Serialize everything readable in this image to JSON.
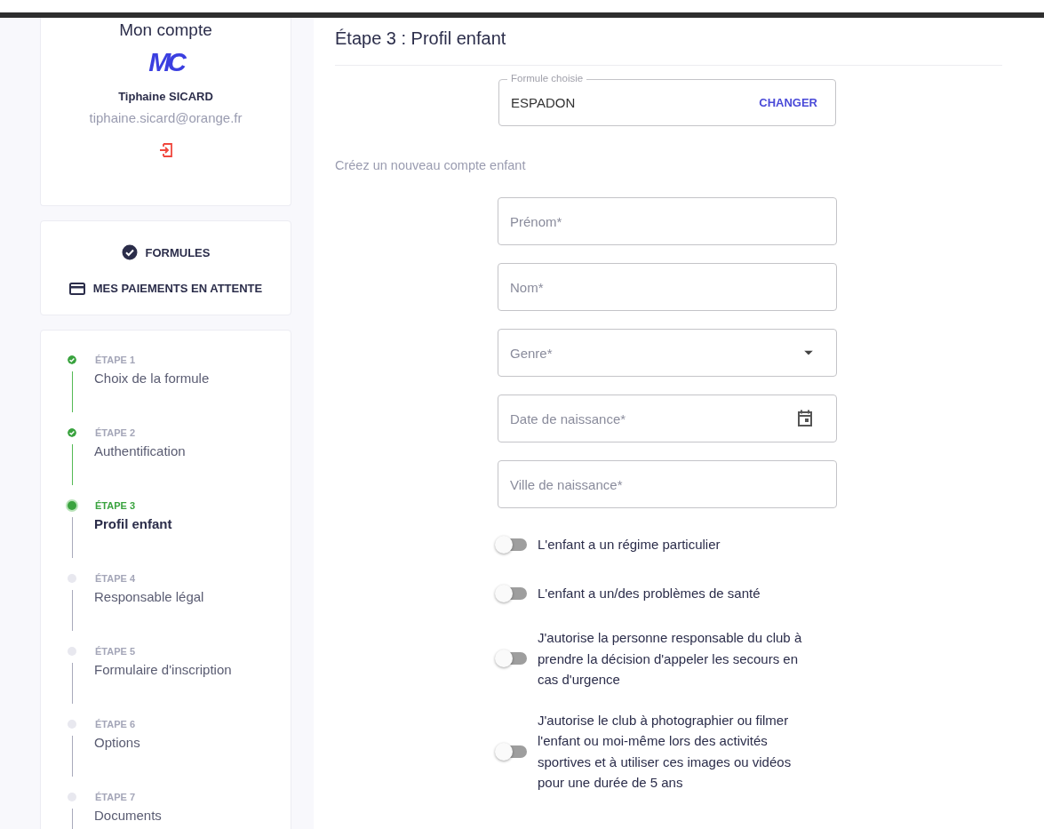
{
  "account": {
    "title": "Mon compte",
    "logo": "MC",
    "name": "Tiphaine SICARD",
    "email": "tiphaine.sicard@orange.fr"
  },
  "menu": [
    {
      "label": "FORMULES",
      "kind": "check"
    },
    {
      "label": "MES PAIEMENTS EN ATTENTE",
      "kind": "card"
    }
  ],
  "steps": [
    {
      "label": "ÉTAPE 1",
      "title": "Choix de la formule",
      "completed": true,
      "selected": false
    },
    {
      "label": "ÉTAPE 2",
      "title": "Authentification",
      "completed": true,
      "selected": false
    },
    {
      "label": "ÉTAPE 3",
      "title": "Profil enfant",
      "completed": false,
      "selected": true
    },
    {
      "label": "ÉTAPE 4",
      "title": "Responsable légal",
      "completed": false,
      "selected": false
    },
    {
      "label": "ÉTAPE 5",
      "title": "Formulaire d'inscription",
      "completed": false,
      "selected": false
    },
    {
      "label": "ÉTAPE 6",
      "title": "Options",
      "completed": false,
      "selected": false
    },
    {
      "label": "ÉTAPE 7",
      "title": "Documents",
      "completed": false,
      "selected": false
    }
  ],
  "heading": "Étape 3 : Profil enfant",
  "formula": {
    "legend": "Formule choisie",
    "value": "ESPADON",
    "action": "CHANGER"
  },
  "intro": "Créez un nouveau compte enfant",
  "fields": [
    {
      "placeholder": "Prénom*",
      "kind": "text"
    },
    {
      "placeholder": "Nom*",
      "kind": "text"
    },
    {
      "placeholder": "Genre*",
      "kind": "select"
    },
    {
      "placeholder": "Date de naissance*",
      "kind": "date"
    },
    {
      "placeholder": "Ville de naissance*",
      "kind": "text"
    }
  ],
  "toggles": [
    {
      "label": "L'enfant a un régime particulier",
      "on": false
    },
    {
      "label": "L'enfant a un/des problèmes de santé",
      "on": false
    },
    {
      "label": "J'autorise la personne responsable du club à prendre la décision d'appeler les secours en cas d'urgence",
      "on": false
    },
    {
      "label": "J'autorise le club à photographier ou filmer l'enfant ou moi-même lors des activités sportives et à utiliser ces images ou vidéos pour une durée de 5 ans",
      "on": false
    }
  ]
}
